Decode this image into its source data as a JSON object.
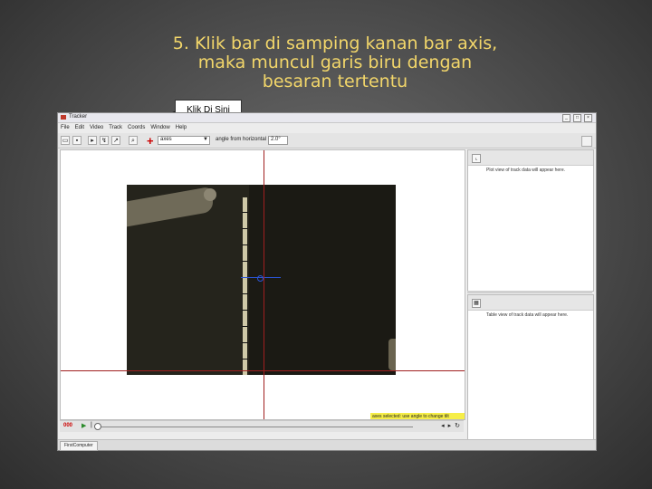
{
  "slide": {
    "title_line1": "5. Klik bar di samping kanan bar axis,",
    "title_line2": "maka muncul garis biru dengan",
    "title_line3": "besaran tertentu",
    "callout_label": "Klik Di Sini",
    "title_color": "#f2d66a"
  },
  "app": {
    "window_title": "Tracker",
    "menus": [
      "File",
      "Edit",
      "Video",
      "Track",
      "Coords",
      "Window",
      "Help"
    ],
    "toolbar": {
      "track_select_value": "axes",
      "angle_label": "angle from horizontal",
      "angle_value": "2.0°"
    },
    "status_message": "axes selected: use angle to change tilt",
    "plot_panel_message": "Plot view of track data will appear here.",
    "table_panel_message": "Table view of track data will appear here.",
    "tab_label": "FirstComputer"
  },
  "colors": {
    "axis_red": "#a01f1f",
    "calibration_blue": "#2b55d8",
    "status_yellow": "#f6ee48"
  }
}
